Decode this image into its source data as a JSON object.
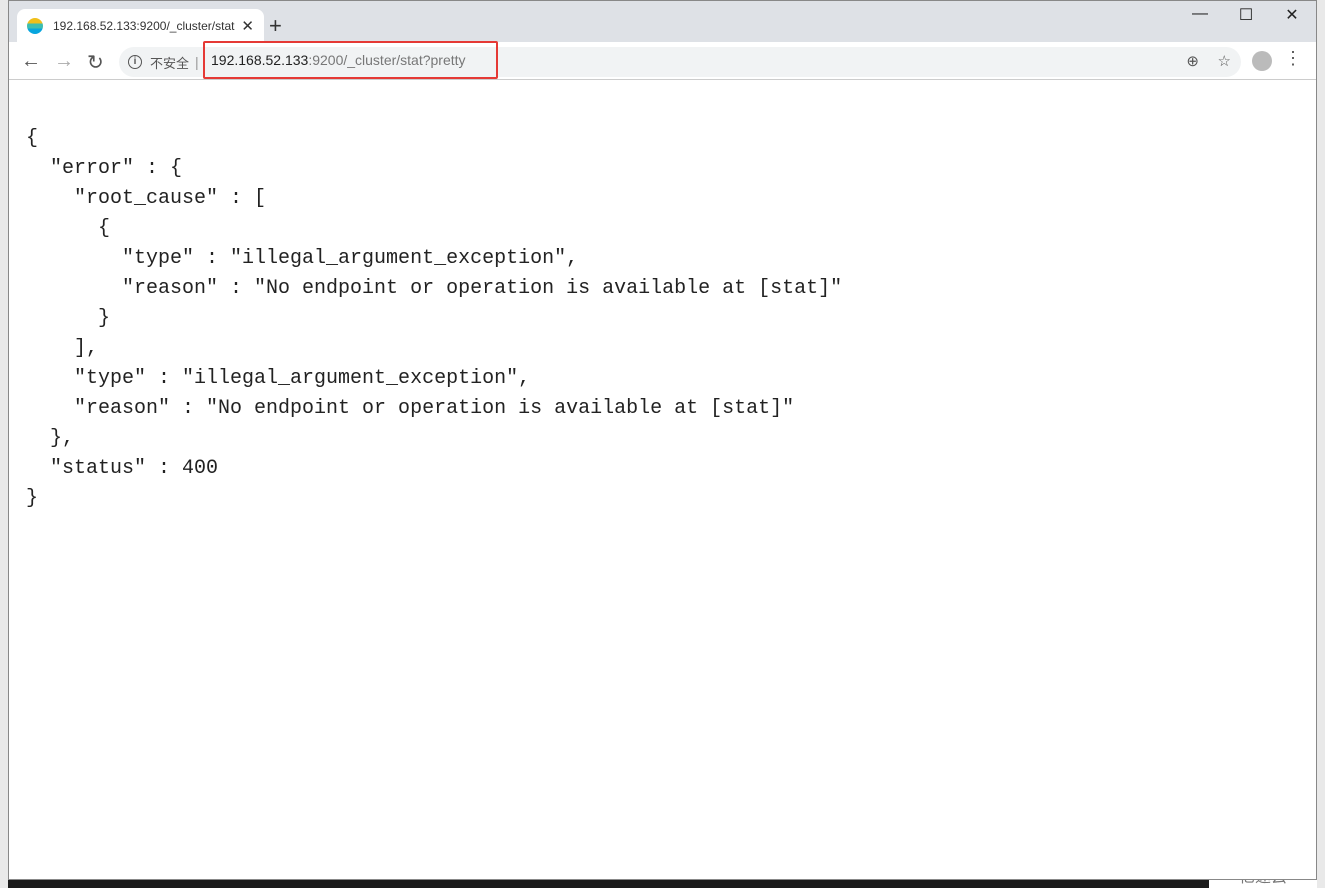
{
  "tab": {
    "title": "192.168.52.133:9200/_cluster/stat?pretty",
    "close": "✕",
    "new_tab": "+"
  },
  "window": {
    "minimize": "—",
    "maximize": "☐",
    "close": "✕"
  },
  "toolbar": {
    "back": "←",
    "forward": "→",
    "reload": "↻",
    "security_label": "不安全",
    "url_host": "192.168.52.133",
    "url_rest": ":9200/_cluster/stat?pretty",
    "zoom_icon": "⊕",
    "star_icon": "☆",
    "menu_icon": "⋮"
  },
  "content": {
    "lines": [
      "{",
      "  \"error\" : {",
      "    \"root_cause\" : [",
      "      {",
      "        \"type\" : \"illegal_argument_exception\",",
      "        \"reason\" : \"No endpoint or operation is available at [stat]\"",
      "      }",
      "    ],",
      "    \"type\" : \"illegal_argument_exception\",",
      "    \"reason\" : \"No endpoint or operation is available at [stat]\"",
      "  },",
      "  \"status\" : 400",
      "}"
    ]
  },
  "watermark": "亿速云",
  "colors": {
    "highlight_border": "#e53935"
  }
}
